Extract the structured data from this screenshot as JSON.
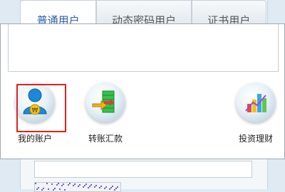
{
  "login_tabs": [
    {
      "label": "普通用户",
      "active": true
    },
    {
      "label": "动态密码用户",
      "active": false
    },
    {
      "label": "证书用户",
      "active": false
    }
  ],
  "popup": {
    "input_value": "",
    "apps": [
      {
        "label": "我的账户",
        "icon": "user-account-icon",
        "selected": true
      },
      {
        "label": "转账汇款",
        "icon": "transfer-icon",
        "selected": false
      },
      {
        "label": "投资理财",
        "icon": "investment-chart-icon",
        "selected": false
      }
    ]
  },
  "colors": {
    "active_tab_text": "#2a5fa8",
    "highlight_border": "#e02020"
  }
}
